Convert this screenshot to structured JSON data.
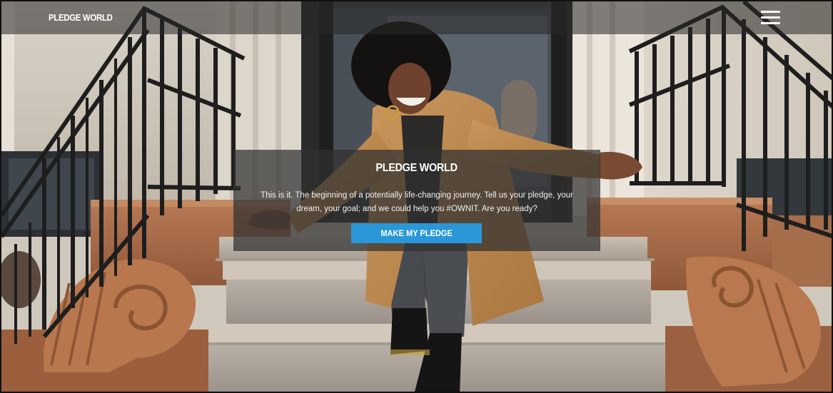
{
  "nav": {
    "brand": "PLEDGE WORLD",
    "menu_icon": "hamburger-menu-icon"
  },
  "hero": {
    "image": "smiling-woman-sitting-on-brownstone-stoop-photo",
    "title": "PLEDGE WORLD",
    "text": "This is it. The beginning of a potentially life-changing journey. Tell us your pledge, your dream, your goal; and we could help you #OWNIT. Are you ready?",
    "cta_label": "MAKE MY PLEDGE"
  },
  "colors": {
    "cta": "#2a97d8",
    "overlay": "#303030",
    "text": "#ffffff"
  }
}
